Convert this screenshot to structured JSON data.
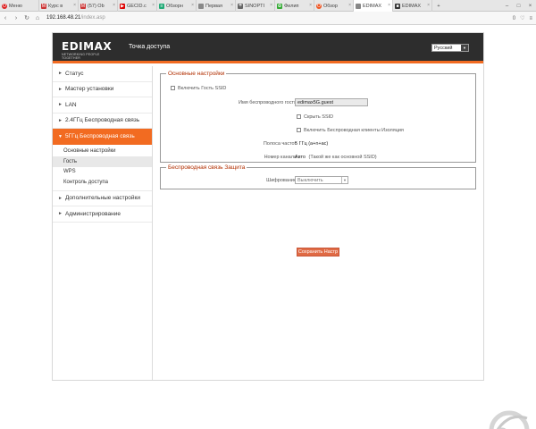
{
  "browser": {
    "tabs": [
      {
        "label": "Меню",
        "icon": "opera-icon",
        "color": "#d22"
      },
      {
        "label": "Курс в",
        "icon": "mail-icon",
        "color": "#c33"
      },
      {
        "label": "(57) Ob",
        "icon": "mail-icon",
        "color": "#c33"
      },
      {
        "label": "GECID.c",
        "icon": "youtube-icon",
        "color": "#d00"
      },
      {
        "label": "Обзорн",
        "icon": "doc-icon",
        "color": "#2a7"
      },
      {
        "label": "Первая",
        "icon": "page-icon",
        "color": "#888"
      },
      {
        "label": "SINOPTI",
        "icon": "weather-icon",
        "color": "#666"
      },
      {
        "label": "Филип",
        "icon": "leaf-icon",
        "color": "#3a3"
      },
      {
        "label": "Обзор",
        "icon": "opera-icon",
        "color": "#e52"
      },
      {
        "label": "EDIMAX",
        "icon": "page-icon",
        "color": "#888"
      },
      {
        "label": "EDIMAX",
        "icon": "router-icon",
        "color": "#333"
      }
    ],
    "new_tab": "+",
    "window_controls": [
      "–",
      "□",
      "×"
    ],
    "address": {
      "host": "192.168.48.21",
      "path": "/index.asp"
    },
    "right_icons": [
      "0",
      "♡",
      "≡"
    ]
  },
  "header": {
    "logo": "EDIMAX",
    "logo_tagline": "NETWORKING PEOPLE TOGETHER",
    "title": "Точка доступа",
    "language": "Русский"
  },
  "sidebar": {
    "items_top": [
      {
        "label": "Статус"
      },
      {
        "label": "Мастер установки"
      },
      {
        "label": "LAN"
      },
      {
        "label": "2.4ГГц Беспроводная связь"
      }
    ],
    "active": {
      "label": "5ГГц Беспроводная связь"
    },
    "sub": [
      {
        "label": "Основные настройки"
      },
      {
        "label": "Гость"
      },
      {
        "label": "WPS"
      },
      {
        "label": "Контроль доступа"
      }
    ],
    "items_bottom": [
      {
        "label": "Дополнительные настройки"
      },
      {
        "label": "Администрирование"
      }
    ]
  },
  "basic": {
    "legend": "Основные настройки",
    "enable_guest": "Включить Гость SSID",
    "ssid_label": "Имя беспроводного гостя",
    "ssid_value": "edimax5G.guest",
    "hide_ssid": "Скрыть SSID",
    "isolation": "Включить Беспроводная клиенты Изоляция",
    "band_label": "Полоса частот",
    "band_value": "5 ГГц (a+n+ac)",
    "channel_label": "Номер канала",
    "channel_value": "Авто",
    "channel_note": "(Такой же как основной SSID)"
  },
  "security": {
    "legend": "Беспроводная связь Защита",
    "encryption_label": "Шифрование",
    "encryption_value": "Выключить"
  },
  "actions": {
    "save": "Сохранить Настр"
  }
}
